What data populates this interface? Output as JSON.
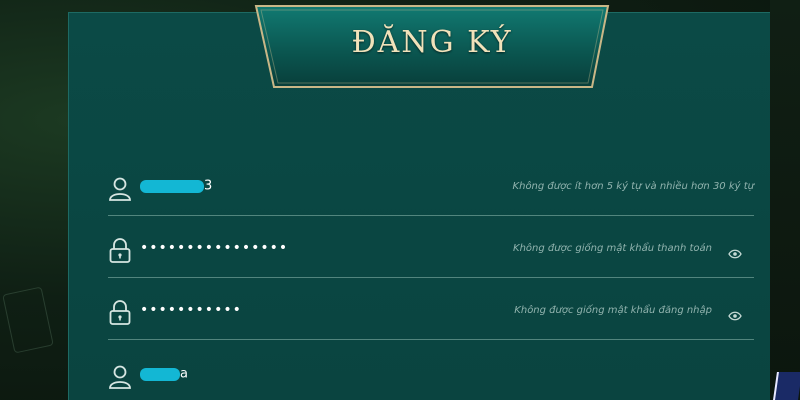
{
  "form": {
    "title": "ĐĂNG KÝ",
    "fields": [
      {
        "icon": "user-icon",
        "value_tail": "3",
        "value_masked": true,
        "hint": "Không được ít hơn 5 ký tự và nhiều hơn 30 ký tự"
      },
      {
        "icon": "lock-icon",
        "value": "••••••••••••••••",
        "hint": "Không được giống mật khẩu thanh toán",
        "toggle_icon": "eye-icon"
      },
      {
        "icon": "lock-icon",
        "value": "•••••••••••",
        "hint": "Không được giống mật khẩu đăng nhập",
        "toggle_icon": "eye-icon"
      },
      {
        "icon": "user-icon",
        "value_tail": "a",
        "value_masked": true
      }
    ]
  },
  "colors": {
    "panel": "#0b4a46",
    "title_text": "#f1e2ba",
    "title_border": "#c9b787",
    "redaction": "#13b7d4"
  }
}
